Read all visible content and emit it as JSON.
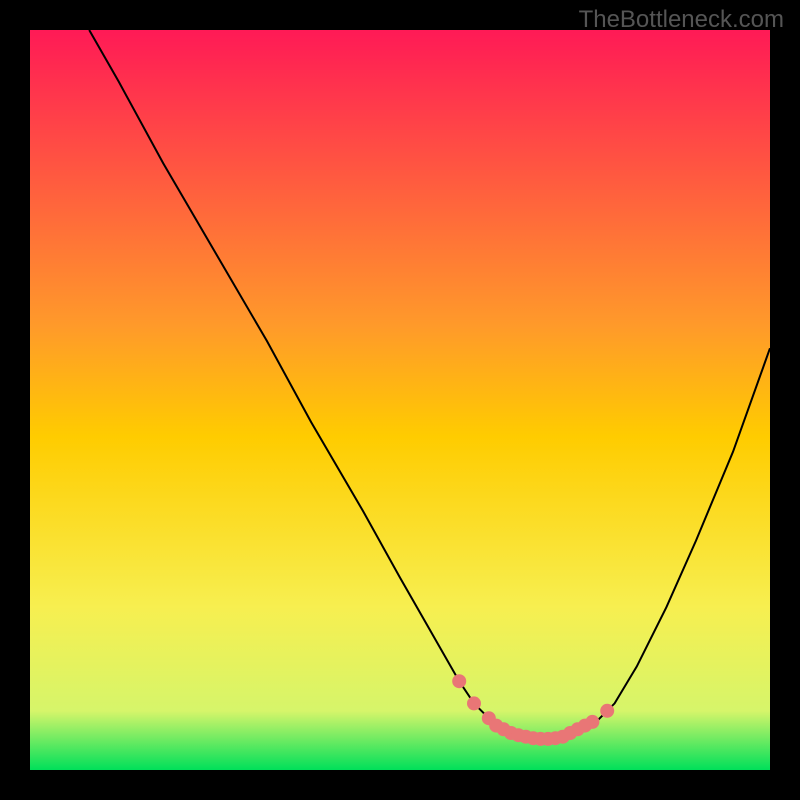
{
  "watermark": "TheBottleneck.com",
  "chart_data": {
    "type": "line",
    "title": "",
    "xlabel": "",
    "ylabel": "",
    "xlim": [
      0,
      100
    ],
    "ylim": [
      0,
      100
    ],
    "series": [
      {
        "name": "curve",
        "x": [
          8,
          12,
          18,
          25,
          32,
          38,
          45,
          50,
          54,
          58,
          60,
          62,
          65,
          68,
          70,
          72,
          74,
          76,
          79,
          82,
          86,
          90,
          95,
          100
        ],
        "y": [
          100,
          93,
          82,
          70,
          58,
          47,
          35,
          26,
          19,
          12,
          9,
          7,
          5,
          4,
          4,
          4,
          5,
          6,
          9,
          14,
          22,
          31,
          43,
          57
        ]
      }
    ],
    "valley_points": {
      "name": "highlight",
      "x": [
        58,
        60,
        62,
        63,
        64,
        65,
        66,
        67,
        68,
        69,
        70,
        71,
        72,
        73,
        74,
        75,
        76,
        78
      ],
      "y": [
        12,
        9,
        7,
        6,
        5.5,
        5,
        4.7,
        4.5,
        4.3,
        4.2,
        4.2,
        4.3,
        4.5,
        5,
        5.5,
        6,
        6.5,
        8
      ]
    },
    "colors": {
      "top": "#ff1a56",
      "mid": "#ffcc00",
      "bottom": "#00e05a",
      "curve": "#000000",
      "highlight": "#e97676"
    }
  }
}
